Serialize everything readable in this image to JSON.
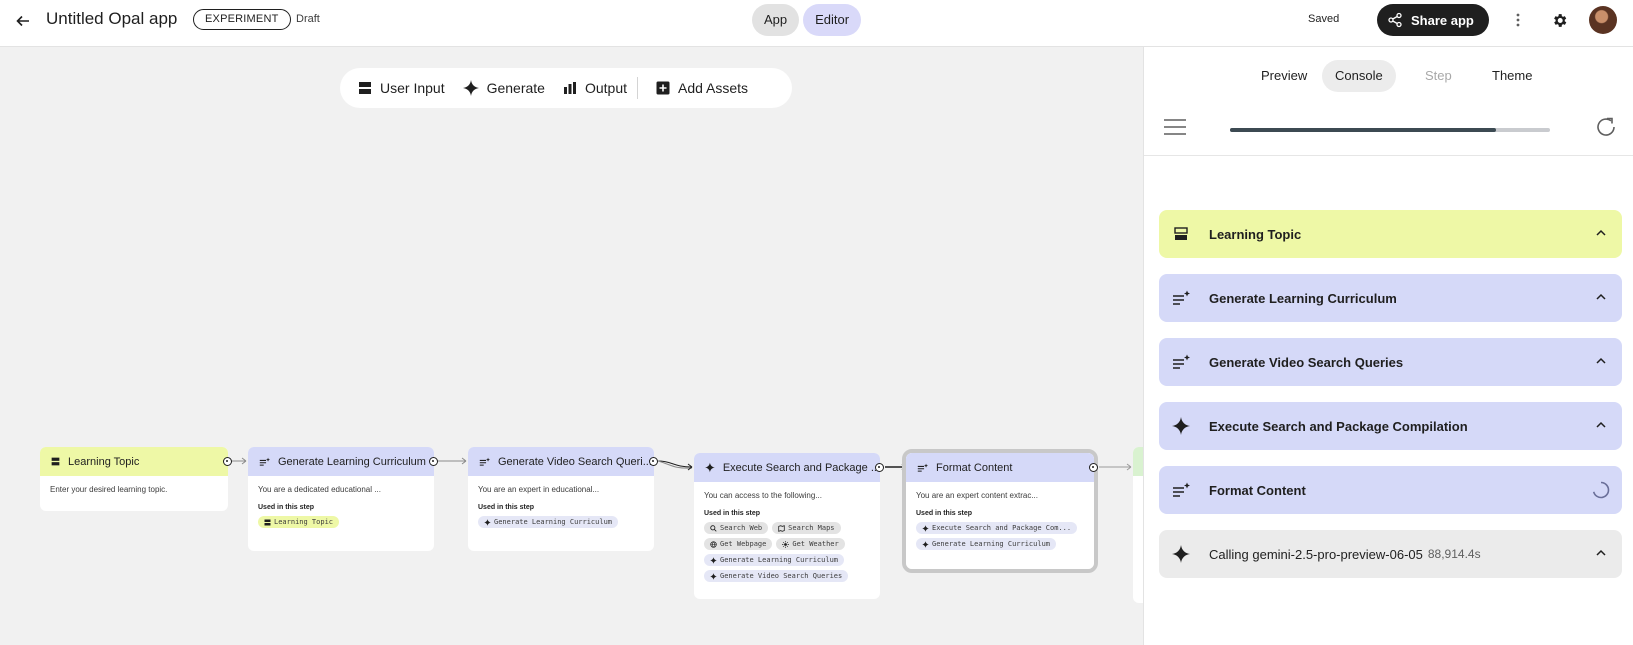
{
  "header": {
    "title": "Untitled Opal app",
    "badge": "EXPERIMENT",
    "status": "Draft",
    "modes": [
      "App",
      "Editor"
    ],
    "saved": "Saved",
    "share": "Share app"
  },
  "toolbar": {
    "items": [
      "User Input",
      "Generate",
      "Output",
      "Add Assets"
    ]
  },
  "nodes": [
    {
      "title": "Learning Topic",
      "desc": "Enter your desired learning topic."
    },
    {
      "title": "Generate Learning Curriculum",
      "desc": "You are a dedicated educational ...",
      "used": "Used in this step",
      "chips": [
        "Learning Topic"
      ]
    },
    {
      "title": "Generate Video Search Queri...",
      "desc": "You are an expert in educational...",
      "used": "Used in this step",
      "chips": [
        "Generate Learning Curriculum"
      ]
    },
    {
      "title": "Execute Search and Package ...",
      "desc": "You can access to the following...",
      "used": "Used in this step",
      "chips": [
        "Search Web",
        "Search Maps",
        "Get Webpage",
        "Get Weather",
        "Generate Learning Curriculum",
        "Generate Video Search Queries"
      ]
    },
    {
      "title": "Format Content",
      "desc": "You are an expert content extrac...",
      "used": "Used in this step",
      "chips": [
        "Execute Search and Package Com...",
        "Generate Learning Curriculum"
      ]
    }
  ],
  "panel": {
    "tabs": [
      "Preview",
      "Console",
      "Step",
      "Theme"
    ],
    "active_tab": "Console",
    "progress": 0.83,
    "items": [
      {
        "label": "Learning Topic",
        "color": "yellow"
      },
      {
        "label": "Generate Learning Curriculum",
        "color": "blue"
      },
      {
        "label": "Generate Video Search Queries",
        "color": "blue"
      },
      {
        "label": "Execute Search and Package Compilation",
        "color": "blue"
      },
      {
        "label": "Format Content",
        "color": "blue",
        "state": "loading"
      },
      {
        "label": "Calling gemini-2.5-pro-preview-06-05",
        "meta": "88,914.4s",
        "color": "gray"
      }
    ]
  },
  "colors": {
    "yellow": "#eef8a6",
    "blue": "#d5d9f8",
    "editor": "#d9d9f9",
    "dark": "#1f1f1f"
  }
}
